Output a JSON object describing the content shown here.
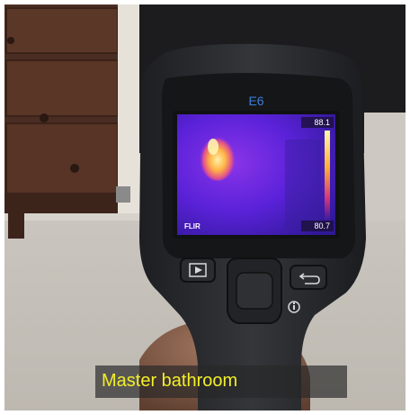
{
  "photo": {
    "subject": "FLIR E6 thermal imaging camera held in hand",
    "device": {
      "model_label": "E6",
      "brand_label": "FLIR",
      "temperature_max": "88.1",
      "temperature_min": "80.7"
    },
    "caption": "Master bathroom",
    "colors": {
      "caption_text": "#f2ee2a",
      "caption_bg": "#282828",
      "thermal_purple": "#5a1fd6",
      "thermal_hot": "#ffd24a",
      "device_body": "#2a2b2e"
    },
    "icons": [
      "play-button-icon",
      "back-arrow-icon",
      "info-icon"
    ]
  }
}
